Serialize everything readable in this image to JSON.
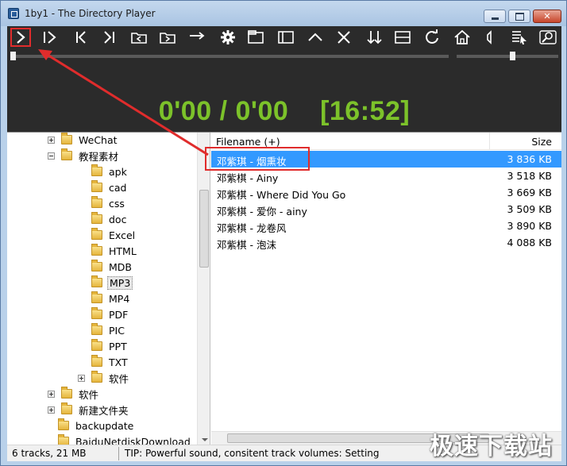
{
  "window": {
    "title": "1by1 - The Directory Player"
  },
  "toolbar": {
    "buttons": [
      {
        "name": "play",
        "icon": "play-icon"
      },
      {
        "name": "play-pause",
        "icon": "pause-play-icon"
      },
      {
        "name": "previous",
        "icon": "previous-icon"
      },
      {
        "name": "next",
        "icon": "next-icon"
      },
      {
        "name": "folder-back",
        "icon": "folder-back-icon"
      },
      {
        "name": "folder-forward",
        "icon": "folder-forward-icon"
      },
      {
        "name": "jump",
        "icon": "arrow-right-icon"
      },
      {
        "name": "settings",
        "icon": "gear-icon"
      },
      {
        "name": "window",
        "icon": "window-icon"
      },
      {
        "name": "panel",
        "icon": "panel-icon"
      },
      {
        "name": "up",
        "icon": "chevron-up-icon"
      },
      {
        "name": "close",
        "icon": "close-icon"
      },
      {
        "name": "sort",
        "icon": "sort-icon"
      },
      {
        "name": "layout",
        "icon": "layout-icon"
      },
      {
        "name": "refresh",
        "icon": "refresh-icon"
      },
      {
        "name": "home",
        "icon": "home-icon"
      },
      {
        "name": "volume",
        "icon": "speaker-icon"
      },
      {
        "name": "playlist",
        "icon": "playlist-icon"
      },
      {
        "name": "search",
        "icon": "search-icon"
      }
    ]
  },
  "player": {
    "elapsed": "0'00",
    "separator": "/",
    "duration": "0'00",
    "total": "[16:52]",
    "seek_position": 0,
    "volume_level": 0.55
  },
  "tree": {
    "items": [
      {
        "label": "WeChat",
        "level": 1,
        "expander": "plus"
      },
      {
        "label": "教程素材",
        "level": 1,
        "expander": "minus"
      },
      {
        "label": "apk",
        "level": 2
      },
      {
        "label": "cad",
        "level": 2
      },
      {
        "label": "css",
        "level": 2
      },
      {
        "label": "doc",
        "level": 2
      },
      {
        "label": "Excel",
        "level": 2
      },
      {
        "label": "HTML",
        "level": 2
      },
      {
        "label": "MDB",
        "level": 2
      },
      {
        "label": "MP3",
        "level": 2,
        "selected": true
      },
      {
        "label": "MP4",
        "level": 2
      },
      {
        "label": "PDF",
        "level": 2
      },
      {
        "label": "PIC",
        "level": 2
      },
      {
        "label": "PPT",
        "level": 2
      },
      {
        "label": "TXT",
        "level": 2
      },
      {
        "label": "软件",
        "level": 2,
        "expander": "plus"
      },
      {
        "label": "软件",
        "level": 1,
        "expander": "plus"
      },
      {
        "label": "新建文件夹",
        "level": 1,
        "expander": "plus"
      },
      {
        "label": "backupdate",
        "level": 0
      },
      {
        "label": "BaiduNetdiskDownload",
        "level": 0
      }
    ]
  },
  "files": {
    "header_name": "Filename (+)",
    "header_size": "Size",
    "rows": [
      {
        "name": "邓紫琪 - 烟熏妆",
        "size": "3 836 KB",
        "selected": true
      },
      {
        "name": "邓紫棋 - Ainy",
        "size": "3 518 KB"
      },
      {
        "name": "邓紫棋 - Where Did You Go",
        "size": "3 669 KB"
      },
      {
        "name": "邓紫棋 - 爱你 - ainy",
        "size": "3 509 KB"
      },
      {
        "name": "邓紫棋 - 龙卷风",
        "size": "3 890 KB"
      },
      {
        "name": "邓紫棋 - 泡沫",
        "size": "4 088 KB"
      }
    ]
  },
  "status": {
    "summary": "6 tracks, 21 MB",
    "tip": "TIP: Powerful sound, consitent track volumes: Setting"
  },
  "watermark": "极速下载站",
  "colors": {
    "time_green": "#7cc22a",
    "selection_blue": "#3399ff",
    "annotation_red": "#e02c2c",
    "player_bg": "#2b2b2b"
  }
}
